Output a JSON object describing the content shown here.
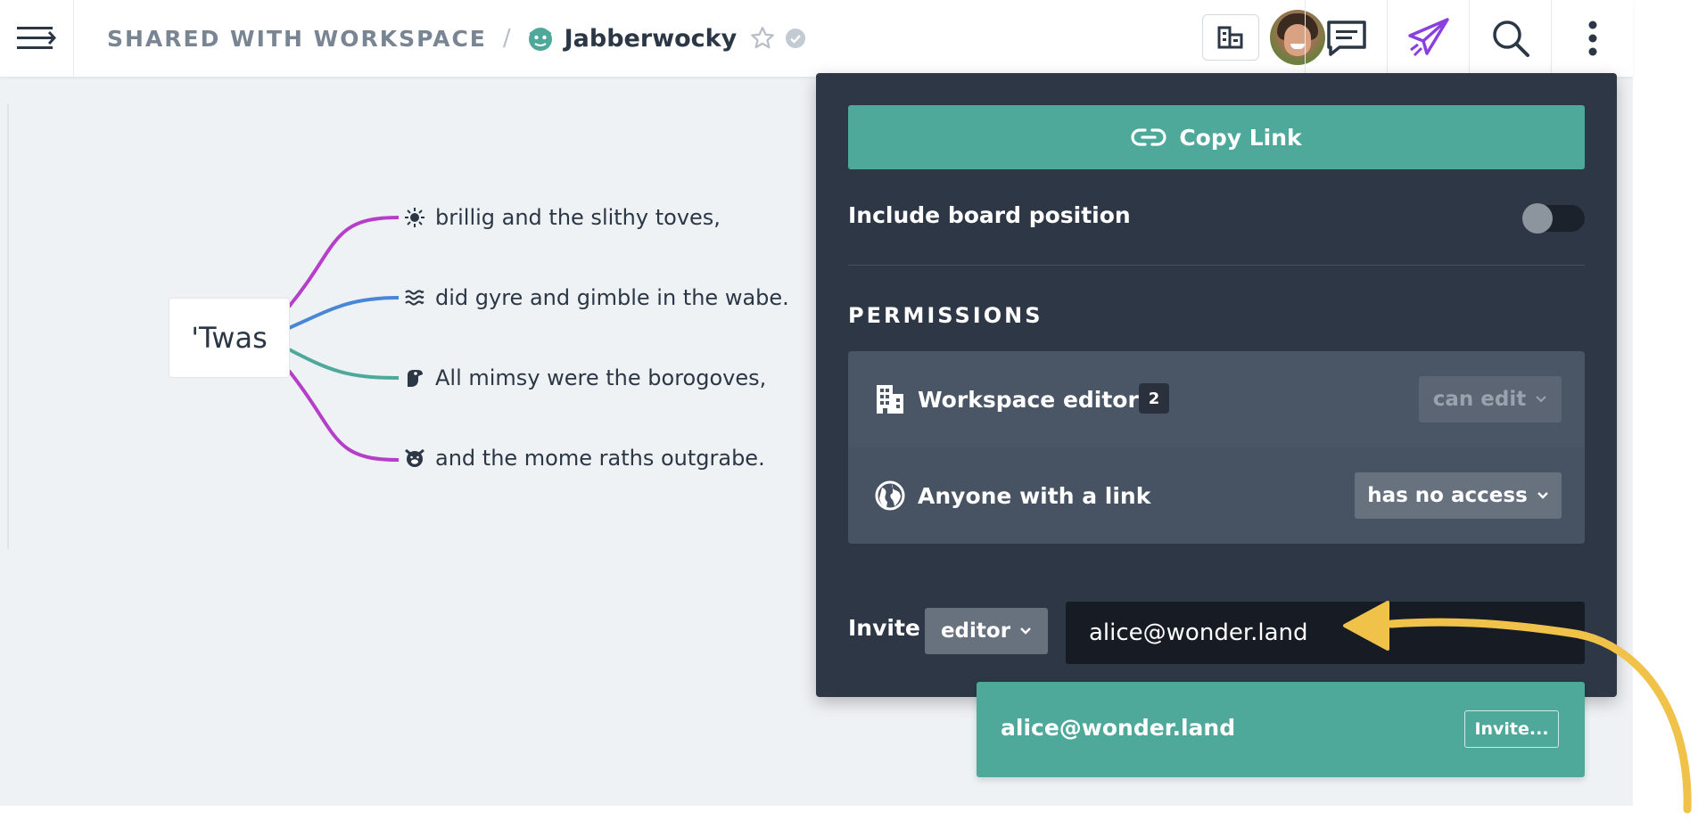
{
  "topbar": {
    "breadcrumb_root": "SHARED WITH WORKSPACE",
    "breadcrumb_separator": "/",
    "board_title": "Jabberwocky"
  },
  "mindmap": {
    "root_label": "'Twas",
    "branches": [
      {
        "icon": "sun-icon",
        "text": "brillig and the slithy toves,",
        "color": "#b53fc9"
      },
      {
        "icon": "waves-icon",
        "text": "did gyre and gimble in the wabe.",
        "color": "#4a86d6"
      },
      {
        "icon": "bird-icon",
        "text": "All mimsy were the borogoves,",
        "color": "#4fa99b"
      },
      {
        "icon": "pig-face-icon",
        "text": "and the mome raths outgrabe.",
        "color": "#b53fc9"
      }
    ]
  },
  "share_panel": {
    "copy_link_label": "Copy Link",
    "include_board_position_label": "Include board position",
    "include_board_position_on": false,
    "permissions_heading": "PERMISSIONS",
    "permissions": [
      {
        "icon": "building-icon",
        "label": "Workspace editors",
        "count": "2",
        "access": "can edit"
      },
      {
        "icon": "globe-icon",
        "label": "Anyone with a link",
        "access": "has no access"
      }
    ],
    "invite_label": "Invite",
    "invite_role": "editor",
    "invite_email_value": "alice@wonder.land"
  },
  "suggestion": {
    "email": "alice@wonder.land",
    "invite_button": "Invite..."
  },
  "colors": {
    "accent": "#4fa99b",
    "panel_bg": "#2e3745",
    "share_icon": "#8a3fe0",
    "annotation_arrow": "#f0c24a"
  }
}
